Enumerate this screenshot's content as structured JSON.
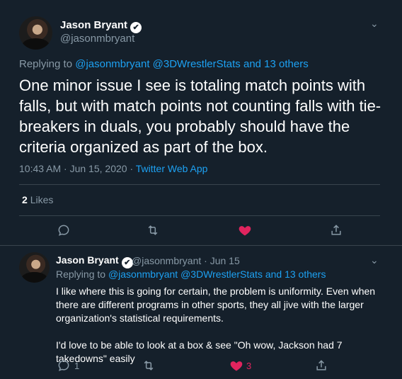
{
  "main_tweet": {
    "author_name": "Jason Bryant",
    "verified_glyph": "✔",
    "handle": "@jasonmbryant",
    "replying_prefix": "Replying to",
    "replying_mentions": "@jasonmbryant @3DWrestlerStats and 13 others",
    "text": "One minor issue I see is totaling match points with falls, but with match points not counting falls with tie-breakers in duals, you probably should have the criteria organized as part of the box.",
    "timestamp": "10:43 AM · Jun 15, 2020 · ",
    "client": "Twitter Web App",
    "likes_count": "2",
    "likes_label": "Likes",
    "actions": [
      "reply-icon",
      "retweet-icon",
      "heart-icon",
      "share-icon"
    ]
  },
  "reply_tweet": {
    "author_name": "Jason Bryant",
    "verified_glyph": "✔",
    "handle_date": "@jasonmbryant · Jun 15",
    "replying_prefix": "Replying to",
    "replying_mentions": "@jasonmbryant @3DWrestlerStats and 13 others",
    "paragraph_1": "I like where this is going for certain, the problem is uniformity. Even when there are different programs in other sports, they all jive with the larger organization's statistical requirements.",
    "paragraph_2": "I'd love to be able to look at a box & see \"Oh wow, Jackson had 7 takedowns\" easily",
    "reply_count": "1",
    "like_count": "3"
  },
  "colors": {
    "background": "#15202b",
    "accent": "#1da1f2",
    "like": "#e0245e",
    "muted": "#8899a6"
  }
}
